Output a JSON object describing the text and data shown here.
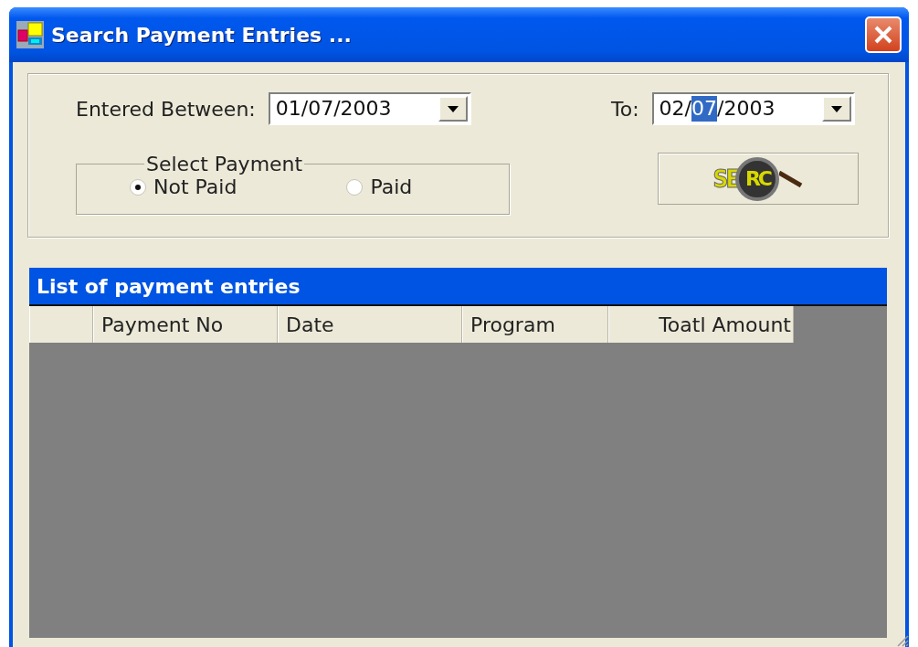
{
  "window": {
    "title": "Search Payment Entries ..."
  },
  "filter": {
    "from": {
      "label": "Entered Between:",
      "parts": [
        {
          "text": "01/07/2003",
          "selected": false
        }
      ]
    },
    "to": {
      "label": "To:",
      "parts": [
        {
          "text": "02/",
          "selected": false
        },
        {
          "text": "07",
          "selected": true
        },
        {
          "text": "/2003",
          "selected": false
        }
      ]
    },
    "payment_group": {
      "title": "Select Payment",
      "options": [
        {
          "label": "Not Paid",
          "selected": true
        },
        {
          "label": "Paid",
          "selected": false
        }
      ]
    },
    "search_button": {
      "logo_left": "SE",
      "logo_lens": "RC"
    }
  },
  "grid": {
    "caption": "List of payment entries",
    "columns": [
      {
        "label": "Payment No",
        "kind": "text"
      },
      {
        "label": "Date",
        "kind": "text"
      },
      {
        "label": "Program",
        "kind": "text"
      },
      {
        "label": "Toatl Amount",
        "kind": "number"
      }
    ]
  }
}
